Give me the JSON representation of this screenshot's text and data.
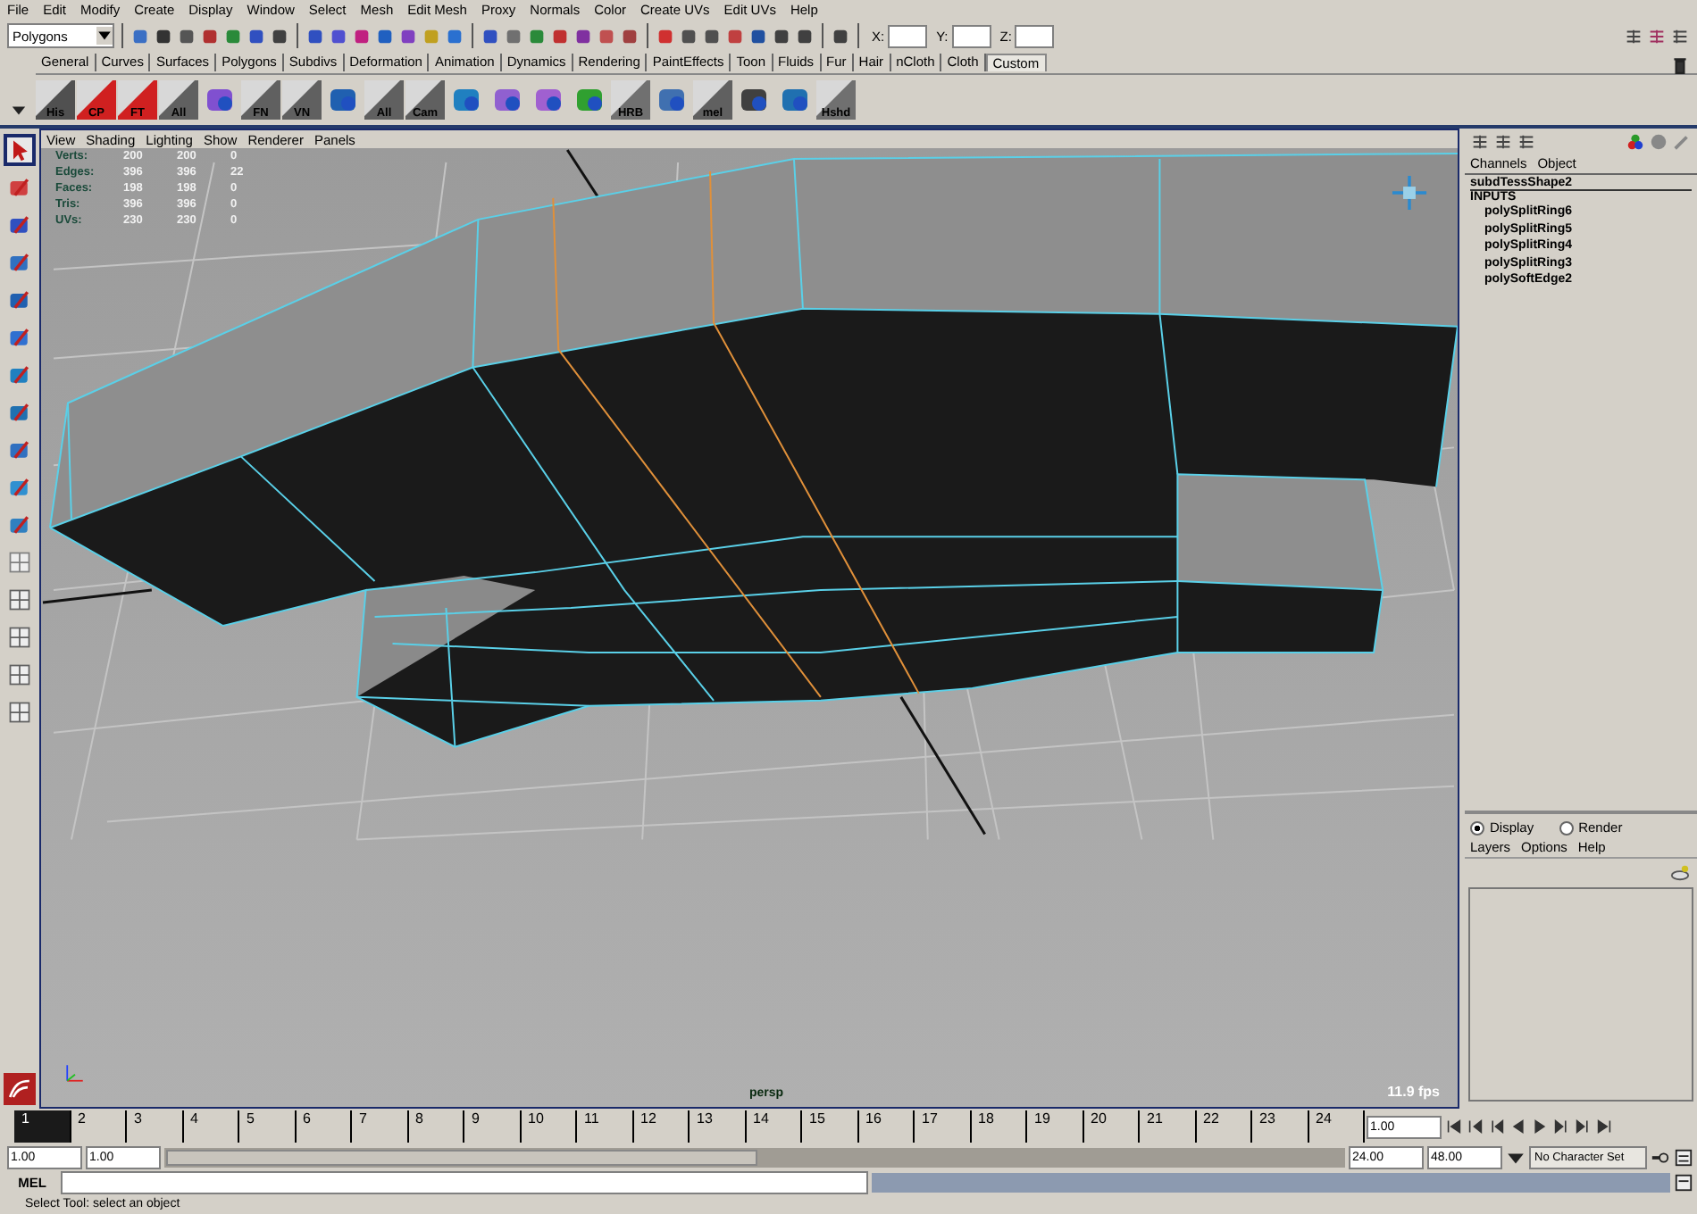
{
  "menu_bar": [
    "File",
    "Edit",
    "Modify",
    "Create",
    "Display",
    "Window",
    "Select",
    "Mesh",
    "Edit Mesh",
    "Proxy",
    "Normals",
    "Color",
    "Create UVs",
    "Edit UVs",
    "Help"
  ],
  "status_line": {
    "mode": "Polygons",
    "x_label": "X:",
    "y_label": "Y:",
    "z_label": "Z:"
  },
  "shelf_tabs": [
    {
      "label": "General",
      "selected": false
    },
    {
      "label": "Curves",
      "selected": false
    },
    {
      "label": "Surfaces",
      "selected": false
    },
    {
      "label": "Polygons",
      "selected": false
    },
    {
      "label": "Subdivs",
      "selected": false
    },
    {
      "label": "Deformation",
      "selected": false
    },
    {
      "label": "Animation",
      "selected": false
    },
    {
      "label": "Dynamics",
      "selected": false
    },
    {
      "label": "Rendering",
      "selected": false
    },
    {
      "label": "PaintEffects",
      "selected": false
    },
    {
      "label": "Toon",
      "selected": false
    },
    {
      "label": "Fluids",
      "selected": false
    },
    {
      "label": "Fur",
      "selected": false
    },
    {
      "label": "Hair",
      "selected": false
    },
    {
      "label": "nCloth",
      "selected": false
    },
    {
      "label": "Cloth",
      "selected": false
    },
    {
      "label": "Custom",
      "selected": true
    }
  ],
  "shelf_buttons": [
    {
      "kind": "labeled",
      "label": "His"
    },
    {
      "kind": "labeled",
      "label": "CP"
    },
    {
      "kind": "labeled",
      "label": "FT"
    },
    {
      "kind": "labeled",
      "label": "All"
    },
    {
      "kind": "icon"
    },
    {
      "kind": "labeled",
      "label": "FN"
    },
    {
      "kind": "labeled",
      "label": "VN"
    },
    {
      "kind": "icon"
    },
    {
      "kind": "labeled",
      "label": "All"
    },
    {
      "kind": "labeled",
      "label": "Cam"
    },
    {
      "kind": "icon"
    },
    {
      "kind": "icon"
    },
    {
      "kind": "icon"
    },
    {
      "kind": "icon"
    },
    {
      "kind": "labeled",
      "label": "HRB"
    },
    {
      "kind": "icon"
    },
    {
      "kind": "labeled",
      "label": "mel"
    },
    {
      "kind": "icon"
    },
    {
      "kind": "icon"
    },
    {
      "kind": "labeled",
      "label": "Hshd"
    }
  ],
  "tools": [
    {
      "selected": true
    },
    {
      "selected": false
    },
    {
      "selected": false
    },
    {
      "selected": false
    },
    {
      "selected": false
    },
    {
      "selected": false
    },
    {
      "selected": false
    },
    {
      "selected": false
    },
    {
      "selected": false
    },
    {
      "selected": false
    },
    {
      "selected": false
    },
    {
      "selected": false
    },
    {
      "selected": false
    },
    {
      "selected": false
    },
    {
      "selected": false
    },
    {
      "selected": false
    }
  ],
  "viewport": {
    "menu": [
      "View",
      "Shading",
      "Lighting",
      "Show",
      "Renderer",
      "Panels"
    ],
    "hud": [
      {
        "label": "Verts:",
        "values": [
          "200",
          "200",
          "0"
        ]
      },
      {
        "label": "Edges:",
        "values": [
          "396",
          "396",
          "22"
        ]
      },
      {
        "label": "Faces:",
        "values": [
          "198",
          "198",
          "0"
        ]
      },
      {
        "label": "Tris:",
        "values": [
          "396",
          "396",
          "0"
        ]
      },
      {
        "label": "UVs:",
        "values": [
          "230",
          "230",
          "0"
        ]
      }
    ],
    "camera": "persp",
    "fps": "11.9 fps"
  },
  "channel_box": {
    "tabs": [
      "Channels",
      "Object"
    ],
    "node": "subdTessShape2",
    "section": "INPUTS",
    "inputs": [
      "polySplitRing6",
      "polySplitRing5",
      "polySplitRing4",
      "polySplitRing3",
      "polySoftEdge2"
    ]
  },
  "layer_editor": {
    "modes": [
      {
        "label": "Display",
        "selected": true
      },
      {
        "label": "Render",
        "selected": false
      }
    ],
    "menu": [
      "Layers",
      "Options",
      "Help"
    ]
  },
  "time_slider": {
    "frames": [
      {
        "label": "1",
        "selected": true
      },
      {
        "label": "2",
        "selected": false
      },
      {
        "label": "3",
        "selected": false
      },
      {
        "label": "4",
        "selected": false
      },
      {
        "label": "5",
        "selected": false
      },
      {
        "label": "6",
        "selected": false
      },
      {
        "label": "7",
        "selected": false
      },
      {
        "label": "8",
        "selected": false
      },
      {
        "label": "9",
        "selected": false
      },
      {
        "label": "10",
        "selected": false
      },
      {
        "label": "11",
        "selected": false
      },
      {
        "label": "12",
        "selected": false
      },
      {
        "label": "13",
        "selected": false
      },
      {
        "label": "14",
        "selected": false
      },
      {
        "label": "15",
        "selected": false
      },
      {
        "label": "16",
        "selected": false
      },
      {
        "label": "17",
        "selected": false
      },
      {
        "label": "18",
        "selected": false
      },
      {
        "label": "19",
        "selected": false
      },
      {
        "label": "20",
        "selected": false
      },
      {
        "label": "21",
        "selected": false
      },
      {
        "label": "22",
        "selected": false
      },
      {
        "label": "23",
        "selected": false
      },
      {
        "label": "24",
        "selected": false
      }
    ],
    "current_time": "1.00"
  },
  "range_slider": {
    "level": 0.5,
    "start": "1.00",
    "range_start": "1.00",
    "range_end": "24.00",
    "end": "48.00",
    "character_set": "No Character Set"
  },
  "command_line": {
    "label": "MEL"
  },
  "help_line": "Select Tool: select an object"
}
